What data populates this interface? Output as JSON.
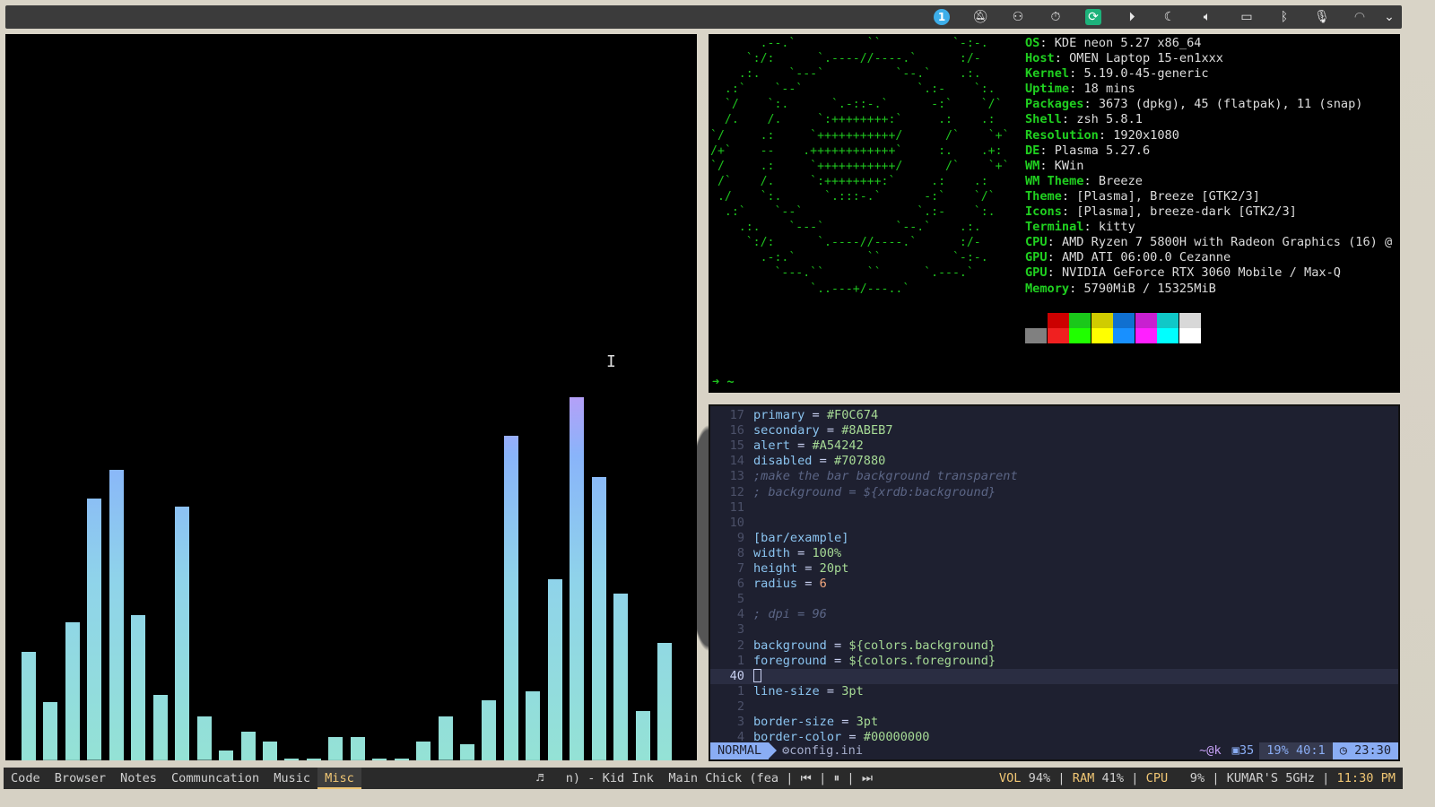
{
  "topbar": {
    "icons": [
      "notification-count-icon",
      "bell-off-icon",
      "user-icon",
      "alarm-icon",
      "sync-app-icon",
      "media-play-icon",
      "night-color-icon",
      "volume-icon",
      "battery-icon",
      "bluetooth-icon",
      "microphone-icon",
      "wifi-icon",
      "chevron-down-icon"
    ],
    "notification_count": "1"
  },
  "visualizer": {
    "levels": [
      0.15,
      0.08,
      0.19,
      0.36,
      0.4,
      0.2,
      0.09,
      0.35,
      0.06,
      0.014,
      0.04,
      0.026,
      0.003,
      0.003,
      0.032,
      0.032,
      0.003,
      0.003,
      0.026,
      0.06,
      0.022,
      0.083,
      0.447,
      0.095,
      0.25,
      0.5,
      0.39,
      0.23,
      0.068,
      0.162
    ],
    "colors": [
      "#94e2d5",
      "#89b4fa",
      "#cba6f7"
    ]
  },
  "neofetch": {
    "ascii": "       .--.`          ``          `-:-.\n     `:/:      `.----//----.`      :/-\n    .:.    `---`          `--.`    .:.\n  .:`    `--`                `.:-    `:.\n  `/    `:.      `.-::-.`      -:`    `/`\n  /.    /.     `:++++++++:`     .:    .:\n`/     .:     `+++++++++++/      /`    `+`\n/+`    --    .++++++++++++`     :.    .+:\n`/     .:     `+++++++++++/      /`    `+`\n /`    /.     `:++++++++:`     .:    .:\n ./    `:.      `.:::-.`      -:`    `/`\n  .:`    `--`                `.:-    `:.\n    .:.    `---`          `--.`    .:.\n     `:/:      `.----//----.`      :/-\n       .-:.`          ``          `-:-.\n         `---.``      ``      `.---.`\n              `..---+/---..`",
    "info": [
      {
        "k": "OS",
        "v": "KDE neon 5.27 x86_64"
      },
      {
        "k": "Host",
        "v": "OMEN Laptop 15-en1xxx"
      },
      {
        "k": "Kernel",
        "v": "5.19.0-45-generic"
      },
      {
        "k": "Uptime",
        "v": "18 mins"
      },
      {
        "k": "Packages",
        "v": "3673 (dpkg), 45 (flatpak), 11 (snap)"
      },
      {
        "k": "Shell",
        "v": "zsh 5.8.1"
      },
      {
        "k": "Resolution",
        "v": "1920x1080"
      },
      {
        "k": "DE",
        "v": "Plasma 5.27.6"
      },
      {
        "k": "WM",
        "v": "KWin"
      },
      {
        "k": "WM Theme",
        "v": "Breeze"
      },
      {
        "k": "Theme",
        "v": "[Plasma], Breeze [GTK2/3]"
      },
      {
        "k": "Icons",
        "v": "[Plasma], breeze-dark [GTK2/3]"
      },
      {
        "k": "Terminal",
        "v": "kitty"
      },
      {
        "k": "CPU",
        "v": "AMD Ryzen 7 5800H with Radeon Graphics (16) @"
      },
      {
        "k": "GPU",
        "v": "AMD ATI 06:00.0 Cezanne"
      },
      {
        "k": "GPU",
        "v": "NVIDIA GeForce RTX 3060 Mobile / Max-Q"
      },
      {
        "k": "Memory",
        "v": "5790MiB / 15325MiB"
      }
    ],
    "palette_top": [
      "#000000",
      "#cc0000",
      "#1ac81a",
      "#d0cc00",
      "#1070d0",
      "#c820d0",
      "#10c8c8",
      "#d8d8d8"
    ],
    "palette_bottom": [
      "#808080",
      "#f02020",
      "#20ff00",
      "#ffff00",
      "#1890ff",
      "#ff20ff",
      "#00ffff",
      "#ffffff"
    ],
    "prompt": "➜  ~"
  },
  "editor": {
    "lines": [
      {
        "n": "17",
        "t": [
          [
            "key",
            "primary"
          ],
          [
            "op",
            " = "
          ],
          [
            "hex",
            "#F0C674"
          ]
        ]
      },
      {
        "n": "16",
        "t": [
          [
            "key",
            "secondary"
          ],
          [
            "op",
            " = "
          ],
          [
            "hex",
            "#8ABEB7"
          ]
        ]
      },
      {
        "n": "15",
        "t": [
          [
            "key",
            "alert"
          ],
          [
            "op",
            " = "
          ],
          [
            "hex",
            "#A54242"
          ]
        ]
      },
      {
        "n": "14",
        "t": [
          [
            "key",
            "disabled"
          ],
          [
            "op",
            " = "
          ],
          [
            "hex",
            "#707880"
          ]
        ]
      },
      {
        "n": "13",
        "t": [
          [
            "com",
            ";make the bar background transparent"
          ]
        ]
      },
      {
        "n": "12",
        "t": [
          [
            "com",
            "; background = ${xrdb:background}"
          ]
        ]
      },
      {
        "n": "11",
        "t": []
      },
      {
        "n": "10",
        "t": []
      },
      {
        "n": "9",
        "t": [
          [
            "sec",
            "[bar/example]"
          ]
        ]
      },
      {
        "n": "8",
        "t": [
          [
            "key",
            "width"
          ],
          [
            "op",
            " = "
          ],
          [
            "val",
            "100%"
          ]
        ]
      },
      {
        "n": "7",
        "t": [
          [
            "key",
            "height"
          ],
          [
            "op",
            " = "
          ],
          [
            "val",
            "20pt"
          ]
        ]
      },
      {
        "n": "6",
        "t": [
          [
            "key",
            "radius"
          ],
          [
            "op",
            " = "
          ],
          [
            "red",
            "6"
          ]
        ]
      },
      {
        "n": "5",
        "t": []
      },
      {
        "n": "4",
        "t": [
          [
            "com",
            "; dpi = 96"
          ]
        ]
      },
      {
        "n": "3",
        "t": []
      },
      {
        "n": "2",
        "t": [
          [
            "key",
            "background"
          ],
          [
            "op",
            " = "
          ],
          [
            "val",
            "${colors.background}"
          ]
        ]
      },
      {
        "n": "1",
        "t": [
          [
            "key",
            "foreground"
          ],
          [
            "op",
            " = "
          ],
          [
            "val",
            "${colors.foreground}"
          ]
        ]
      },
      {
        "n": "40",
        "t": [],
        "current": true
      },
      {
        "n": "1",
        "t": [
          [
            "key",
            "line-size"
          ],
          [
            "op",
            " = "
          ],
          [
            "val",
            "3pt"
          ]
        ]
      },
      {
        "n": "2",
        "t": []
      },
      {
        "n": "3",
        "t": [
          [
            "key",
            "border-size"
          ],
          [
            "op",
            " = "
          ],
          [
            "val",
            "3pt"
          ]
        ]
      },
      {
        "n": "4",
        "t": [
          [
            "key",
            "border-color"
          ],
          [
            "op",
            " = "
          ],
          [
            "val",
            "#00000000"
          ]
        ]
      }
    ],
    "status": {
      "mode": "NORMAL",
      "file": "config.ini",
      "branch": "~@k",
      "lines": "35",
      "percent": "19%",
      "position": "40:1",
      "time": "23:30"
    }
  },
  "bottombar": {
    "workspaces": [
      {
        "label": "Code"
      },
      {
        "label": "Browser"
      },
      {
        "label": "Notes"
      },
      {
        "label": "Communcation"
      },
      {
        "label": "Music"
      },
      {
        "label": "Misc",
        "active": true
      }
    ],
    "music": {
      "icon": "♬",
      "title": "n) - Kid Ink  Main Chick (fea",
      "prev": "⏮",
      "pause": "⏸",
      "next": "⏭"
    },
    "stats": {
      "vol_label": "VOL",
      "vol": "94%",
      "ram_label": "RAM",
      "ram": "41%",
      "cpu_label": "CPU",
      "cpu": " 9%",
      "host": "KUMAR'S 5GHz",
      "time": "11:30 PM"
    }
  }
}
